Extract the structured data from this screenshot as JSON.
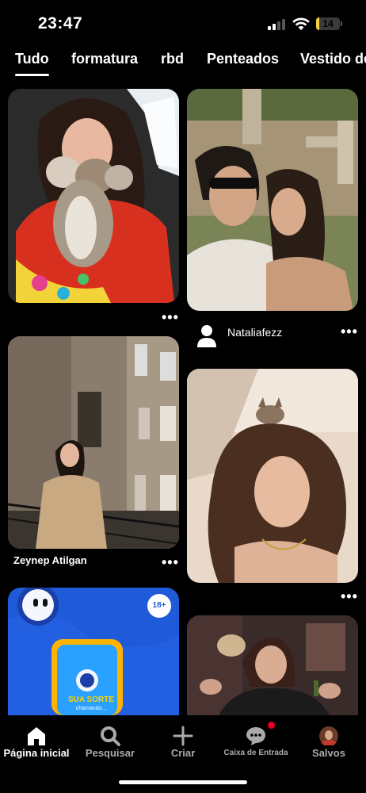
{
  "status_bar": {
    "time": "23:47",
    "battery": "14",
    "battery_level": 0.14
  },
  "tabs": [
    {
      "label": "Tudo",
      "active": true
    },
    {
      "label": "formatura"
    },
    {
      "label": "rbd"
    },
    {
      "label": "Penteados"
    },
    {
      "label": "Vestido de"
    }
  ],
  "pins": {
    "left_2": {
      "caption": "Zeynep Atilgan"
    },
    "right_1": {
      "author": "Nataliafezz"
    },
    "ad": {
      "badge": "18+",
      "phone_text": "SUA SORTE",
      "phone_sub": "chamando..."
    },
    "more": "•••"
  },
  "bottom_nav": [
    {
      "label": "Página inicial",
      "icon": "home-icon",
      "active": true
    },
    {
      "label": "Pesquisar",
      "icon": "search-icon"
    },
    {
      "label": "Criar",
      "icon": "plus-icon"
    },
    {
      "label": "Caixa de Entrada",
      "icon": "chat-icon",
      "badge": true
    },
    {
      "label": "Salvos",
      "icon": "profile-avatar"
    }
  ],
  "colors": {
    "background": "#000000",
    "notification": "#e60023",
    "battery": "#f4d23d",
    "ad_blue": "#1f5ad8"
  }
}
